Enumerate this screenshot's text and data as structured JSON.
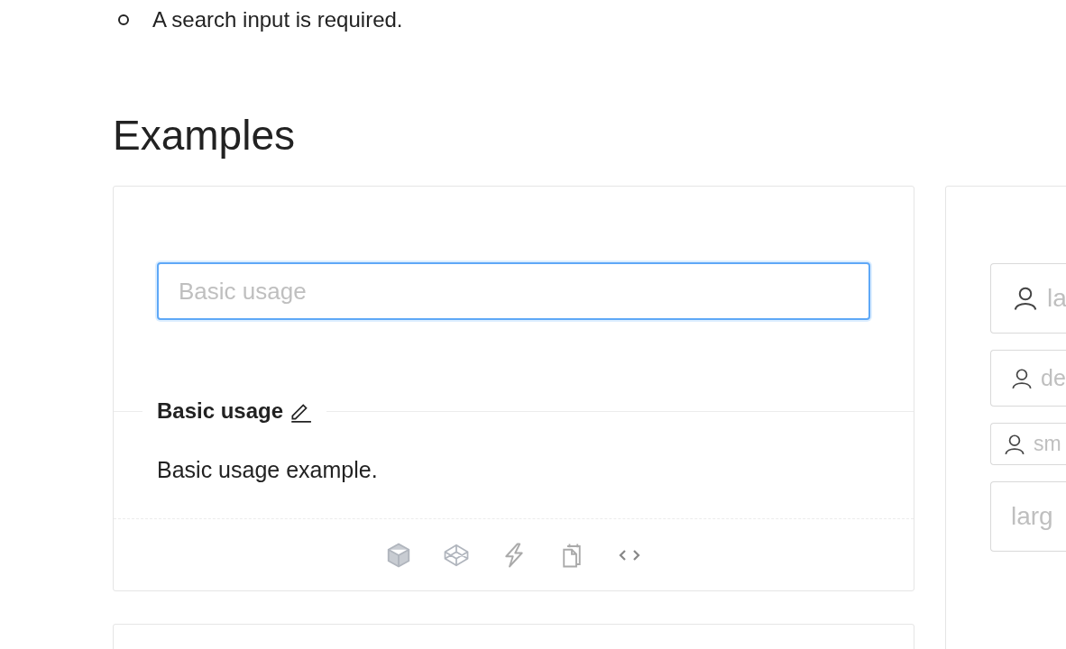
{
  "requirements": [
    "A search input is required."
  ],
  "heading": "Examples",
  "example": {
    "input": {
      "placeholder": "Basic usage",
      "focused": true
    },
    "title": "Basic usage",
    "description": "Basic usage example.",
    "actions": [
      {
        "kind": "codesandbox"
      },
      {
        "kind": "codepen"
      },
      {
        "kind": "stackblitz"
      },
      {
        "kind": "copy"
      },
      {
        "kind": "code"
      }
    ]
  },
  "side_example": {
    "inputs": [
      {
        "kind": "large",
        "placeholder": "la"
      },
      {
        "kind": "default",
        "placeholder": "de"
      },
      {
        "kind": "small",
        "placeholder": "sm"
      },
      {
        "kind": "plain",
        "placeholder": "larg"
      }
    ]
  }
}
